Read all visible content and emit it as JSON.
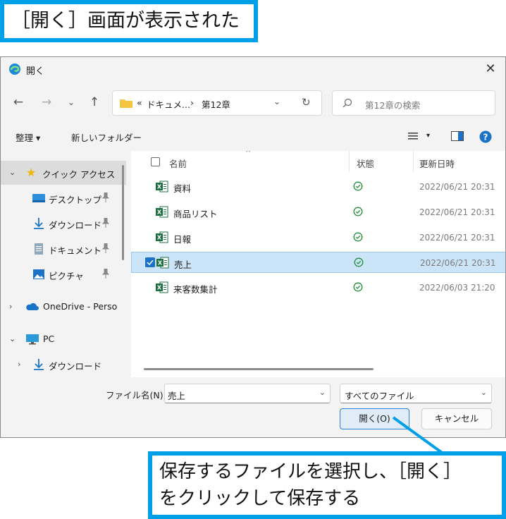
{
  "caption_top": "［開く］画面が表示された",
  "caption_bottom": {
    "line1": "保存するファイルを選択し、［開く］",
    "line2": "をクリックして保存する"
  },
  "dialog": {
    "title": "開く",
    "close_glyph": "✕",
    "nav": {
      "back": "←",
      "forward": "→",
      "recent": "⌄",
      "up": "↑"
    },
    "address": {
      "ellipsis": "«",
      "crumbs": [
        "ドキュメ...",
        "第12章"
      ],
      "separator": "›",
      "dropdown": "⌄",
      "refresh": "↻"
    },
    "search": {
      "placeholder": "第12章の検索"
    },
    "toolbar": {
      "organize": "整理 ▾",
      "new_folder": "新しいフォルダー",
      "view_caret": "▾"
    },
    "nav_pane": [
      {
        "label": "クイック アクセス",
        "expander": "⌄"
      },
      {
        "label": "デスクトップ"
      },
      {
        "label": "ダウンロード"
      },
      {
        "label": "ドキュメント"
      },
      {
        "label": "ピクチャ"
      },
      {
        "label": "OneDrive - Perso",
        "expander": "›"
      },
      {
        "label": "PC",
        "expander": "⌄"
      },
      {
        "label": "ダウンロード",
        "expander": "›"
      }
    ],
    "columns": {
      "name": "名前",
      "status": "状態",
      "modified": "更新日時"
    },
    "files": [
      {
        "name": "資料",
        "modified": "2022/06/21 20:31"
      },
      {
        "name": "商品リスト",
        "modified": "2022/06/21 20:31"
      },
      {
        "name": "日報",
        "modified": "2022/06/21 20:31"
      },
      {
        "name": "売上",
        "modified": "2022/06/21 20:31"
      },
      {
        "name": "来客数集計",
        "modified": "2022/06/03 21:20"
      }
    ],
    "file_name_label": "ファイル名(N):",
    "file_name_value": "売上",
    "file_type": "すべてのファイル",
    "dropdown_glyph": "⌄",
    "open_button": "開く(O)",
    "cancel_button": "キャンセル"
  },
  "colors": {
    "caption_border": "#00a0e9",
    "selection": "#cce4f7",
    "accent": "#1a73c7",
    "excel_green": "#1d6f42"
  }
}
